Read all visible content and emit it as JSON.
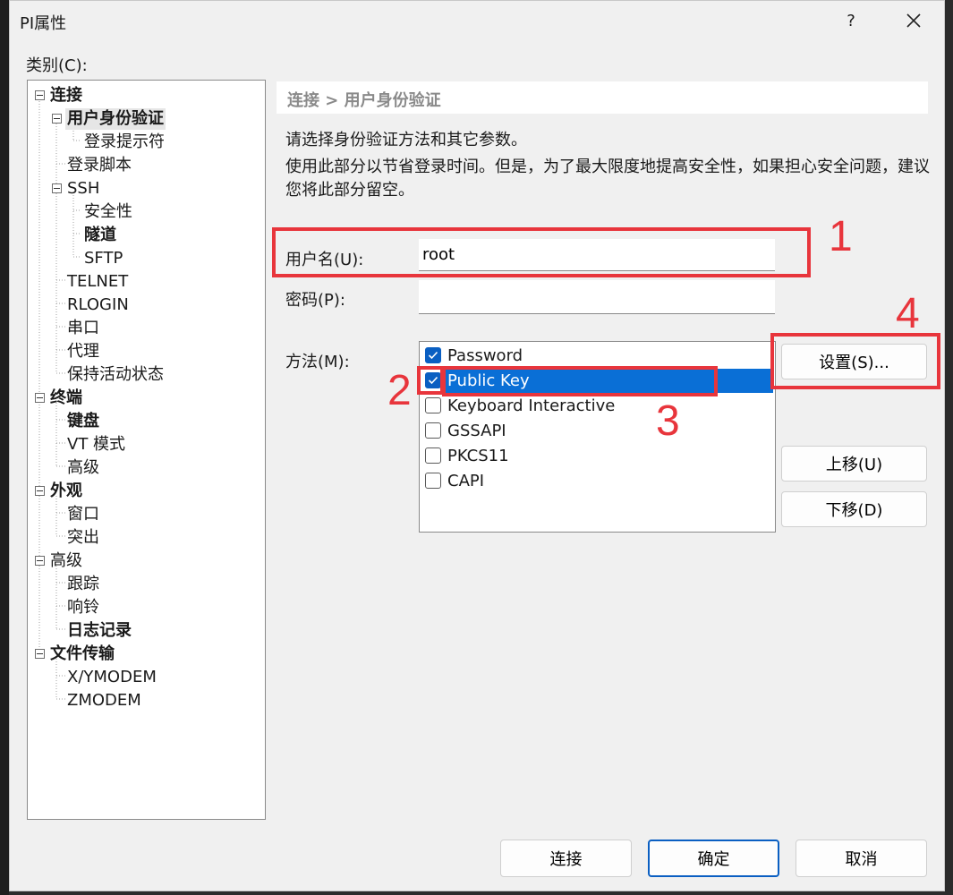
{
  "window": {
    "title": "PI属性",
    "help": "?",
    "close_icon": "close-icon"
  },
  "category_label": "类别(C):",
  "tree": [
    {
      "label": "连接",
      "bold": true
    },
    {
      "label": "用户身份验证",
      "bold": true,
      "selected": true
    },
    {
      "label": "登录提示符"
    },
    {
      "label": "登录脚本"
    },
    {
      "label": "SSH"
    },
    {
      "label": "安全性"
    },
    {
      "label": "隧道",
      "bold": true
    },
    {
      "label": "SFTP"
    },
    {
      "label": "TELNET"
    },
    {
      "label": "RLOGIN"
    },
    {
      "label": "串口"
    },
    {
      "label": "代理"
    },
    {
      "label": "保持活动状态"
    },
    {
      "label": "终端",
      "bold": true
    },
    {
      "label": "键盘",
      "bold": true
    },
    {
      "label": "VT 模式"
    },
    {
      "label": "高级"
    },
    {
      "label": "外观",
      "bold": true
    },
    {
      "label": "窗口"
    },
    {
      "label": "突出"
    },
    {
      "label": "高级"
    },
    {
      "label": "跟踪"
    },
    {
      "label": "响铃"
    },
    {
      "label": "日志记录",
      "bold": true
    },
    {
      "label": "文件传输",
      "bold": true
    },
    {
      "label": "X/YMODEM"
    },
    {
      "label": "ZMODEM"
    }
  ],
  "panel": {
    "breadcrumb": "连接 > 用户身份验证",
    "desc1": "请选择身份验证方法和其它参数。",
    "desc2": "使用此部分以节省登录时间。但是，为了最大限度地提高安全性，如果担心安全问题，建议您将此部分留空。",
    "username_label": "用户名(U):",
    "username_value": "root",
    "password_label": "密码(P):",
    "password_value": "",
    "method_label": "方法(M):",
    "methods": [
      {
        "label": "Password",
        "checked": true
      },
      {
        "label": "Public Key",
        "checked": true,
        "selected": true
      },
      {
        "label": "Keyboard Interactive",
        "checked": false
      },
      {
        "label": "GSSAPI",
        "checked": false
      },
      {
        "label": "PKCS11",
        "checked": false
      },
      {
        "label": "CAPI",
        "checked": false
      }
    ],
    "settings_button": "设置(S)...",
    "move_up_button": "上移(U)",
    "move_down_button": "下移(D)"
  },
  "footer": {
    "connect": "连接",
    "ok": "确定",
    "cancel": "取消"
  },
  "annotations": [
    "1",
    "2",
    "3",
    "4"
  ],
  "colors": {
    "accent": "#0a6fd6",
    "annotation_red": "#e8353c"
  }
}
